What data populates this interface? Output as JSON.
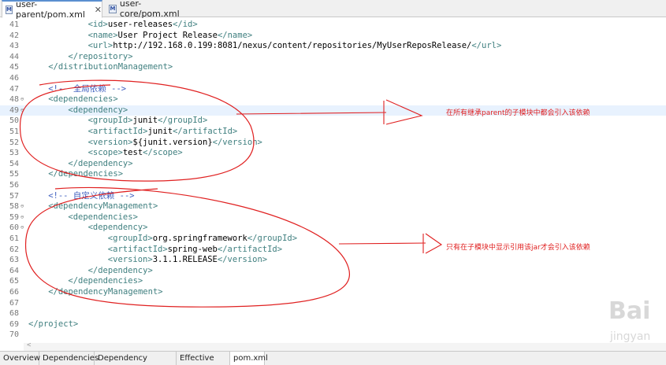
{
  "tabs": [
    {
      "label": "user-parent/pom.xml",
      "icon": "M",
      "close": "✕"
    },
    {
      "label": "user-core/pom.xml",
      "icon": "M"
    }
  ],
  "lines": [
    {
      "n": "41",
      "indent": 12,
      "parts": [
        [
          "tag",
          "<id>"
        ],
        [
          "t",
          "user-releases"
        ],
        [
          "tag",
          "</id>"
        ]
      ]
    },
    {
      "n": "42",
      "indent": 12,
      "parts": [
        [
          "tag",
          "<name>"
        ],
        [
          "t",
          "User Project Release"
        ],
        [
          "tag",
          "</name>"
        ]
      ]
    },
    {
      "n": "43",
      "indent": 12,
      "parts": [
        [
          "tag",
          "<url>"
        ],
        [
          "t",
          "http://192.168.0.199:8081/nexus/content/repositories/MyUserReposRelease/"
        ],
        [
          "tag",
          "</url>"
        ]
      ]
    },
    {
      "n": "44",
      "indent": 8,
      "parts": [
        [
          "tag",
          "</repository>"
        ]
      ]
    },
    {
      "n": "45",
      "indent": 4,
      "parts": [
        [
          "tag",
          "</distributionManagement>"
        ]
      ]
    },
    {
      "n": "46",
      "indent": 0,
      "parts": []
    },
    {
      "n": "47",
      "indent": 4,
      "parts": [
        [
          "cmt",
          "<!-- 全局依赖 -->"
        ]
      ]
    },
    {
      "n": "48",
      "indent": 4,
      "parts": [
        [
          "tag",
          "<dependencies>"
        ]
      ],
      "fold": true
    },
    {
      "n": "49",
      "indent": 8,
      "parts": [
        [
          "tag",
          "<dependency>"
        ]
      ],
      "fold": true,
      "hl": true
    },
    {
      "n": "50",
      "indent": 12,
      "parts": [
        [
          "tag",
          "<groupId>"
        ],
        [
          "t",
          "junit"
        ],
        [
          "tag",
          "</groupId>"
        ]
      ]
    },
    {
      "n": "51",
      "indent": 12,
      "parts": [
        [
          "tag",
          "<artifactId>"
        ],
        [
          "t",
          "junit"
        ],
        [
          "tag",
          "</artifactId>"
        ]
      ]
    },
    {
      "n": "52",
      "indent": 12,
      "parts": [
        [
          "tag",
          "<version>"
        ],
        [
          "t",
          "${junit.version}"
        ],
        [
          "tag",
          "</version>"
        ]
      ]
    },
    {
      "n": "53",
      "indent": 12,
      "parts": [
        [
          "tag",
          "<scope>"
        ],
        [
          "t",
          "test"
        ],
        [
          "tag",
          "</scope>"
        ]
      ]
    },
    {
      "n": "54",
      "indent": 8,
      "parts": [
        [
          "tag",
          "</dependency>"
        ]
      ]
    },
    {
      "n": "55",
      "indent": 4,
      "parts": [
        [
          "tag",
          "</dependencies>"
        ]
      ]
    },
    {
      "n": "56",
      "indent": 0,
      "parts": []
    },
    {
      "n": "57",
      "indent": 4,
      "parts": [
        [
          "cmt",
          "<!-- 自定义依赖 -->"
        ]
      ]
    },
    {
      "n": "58",
      "indent": 4,
      "parts": [
        [
          "tag",
          "<dependencyManagement>"
        ]
      ],
      "fold": true
    },
    {
      "n": "59",
      "indent": 8,
      "parts": [
        [
          "tag",
          "<dependencies>"
        ]
      ],
      "fold": true
    },
    {
      "n": "60",
      "indent": 12,
      "parts": [
        [
          "tag",
          "<dependency>"
        ]
      ],
      "fold": true
    },
    {
      "n": "61",
      "indent": 16,
      "parts": [
        [
          "tag",
          "<groupId>"
        ],
        [
          "t",
          "org.springframework"
        ],
        [
          "tag",
          "</groupId>"
        ]
      ]
    },
    {
      "n": "62",
      "indent": 16,
      "parts": [
        [
          "tag",
          "<artifactId>"
        ],
        [
          "t",
          "spring-web"
        ],
        [
          "tag",
          "</artifactId>"
        ]
      ]
    },
    {
      "n": "63",
      "indent": 16,
      "parts": [
        [
          "tag",
          "<version>"
        ],
        [
          "t",
          "3.1.1.RELEASE"
        ],
        [
          "tag",
          "</version>"
        ]
      ]
    },
    {
      "n": "64",
      "indent": 12,
      "parts": [
        [
          "tag",
          "</dependency>"
        ]
      ]
    },
    {
      "n": "65",
      "indent": 8,
      "parts": [
        [
          "tag",
          "</dependencies>"
        ]
      ]
    },
    {
      "n": "66",
      "indent": 4,
      "parts": [
        [
          "tag",
          "</dependencyManagement>"
        ]
      ]
    },
    {
      "n": "67",
      "indent": 0,
      "parts": []
    },
    {
      "n": "68",
      "indent": 0,
      "parts": []
    },
    {
      "n": "69",
      "indent": 0,
      "parts": [
        [
          "tag",
          "</project>"
        ]
      ]
    },
    {
      "n": "70",
      "indent": 0,
      "parts": []
    }
  ],
  "annotations": {
    "note1": "在所有继承parent的子模块中都会引入该依赖",
    "note2": "只有在子模块中显示引用该jar才会引入该依赖"
  },
  "scrollbar": {
    "left_arrow": "<"
  },
  "bottom_tabs": [
    "Overview",
    "Dependencies",
    "Dependency Hierarchy",
    "Effective POM",
    "pom.xml"
  ],
  "active_bottom_tab": "pom.xml",
  "watermark": {
    "logo": "Bai",
    "sub": "jingyan"
  },
  "colors": {
    "tag": "#3f7f7f",
    "comment": "#3f5fbf",
    "annotation": "#e02020",
    "highlight": "#e8f2fe"
  }
}
